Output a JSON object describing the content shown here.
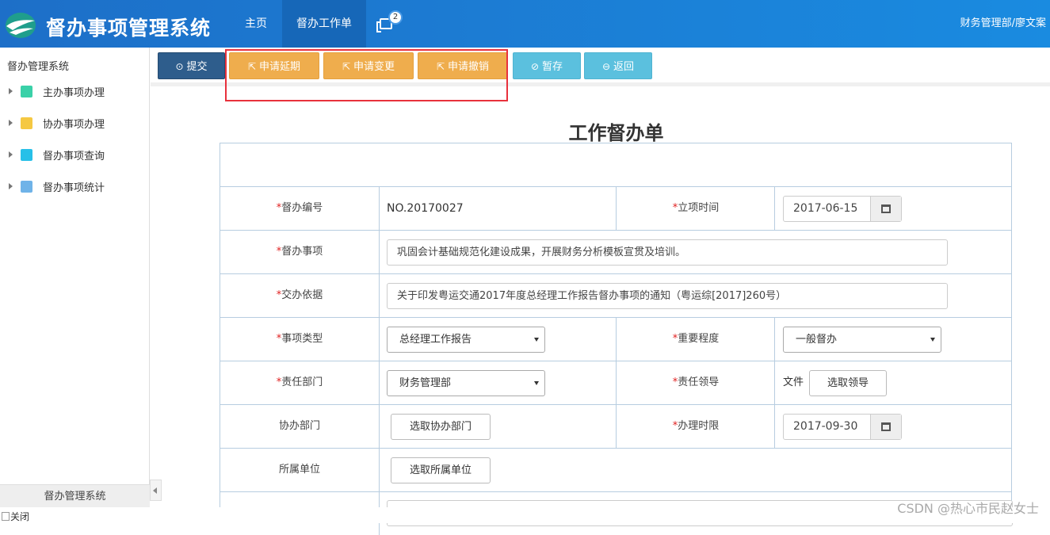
{
  "header": {
    "app_title": "督办事项管理系统",
    "nav": {
      "home": "主页",
      "work_order": "督办工作单",
      "badge_count": "2"
    },
    "user": "财务管理部/廖文案"
  },
  "sidebar": {
    "title": "督办管理系统",
    "items": [
      {
        "label": "主办事项办理",
        "icon": "user-icon",
        "color": "#3ad1a8"
      },
      {
        "label": "协办事项办理",
        "icon": "users-icon",
        "color": "#f5c842"
      },
      {
        "label": "督办事项查询",
        "icon": "search-icon",
        "color": "#27c0e8"
      },
      {
        "label": "督办事项统计",
        "icon": "chart-icon",
        "color": "#6fb3e8"
      }
    ],
    "footer": "督办管理系统"
  },
  "toolbar": {
    "submit": "提交",
    "delay": "申请延期",
    "change": "申请变更",
    "cancel": "申请撤销",
    "save": "暂存",
    "back": "返回"
  },
  "form": {
    "title": "工作督办单",
    "req_mark": "*",
    "code_label": "督办编号",
    "code_value": "NO.20170027",
    "start_label": "立项时间",
    "start_value": "2017-06-15",
    "matter_label": "督办事项",
    "matter_value": "巩固会计基础规范化建设成果，开展财务分析模板宣贯及培训。",
    "basis_label": "交办依据",
    "basis_value": "关于印发粤运交通2017年度总经理工作报告督办事项的通知（粤运综[2017]260号）",
    "type_label": "事项类型",
    "type_value": "总经理工作报告",
    "importance_label": "重要程度",
    "importance_value": "一般督办",
    "dept_label": "责任部门",
    "dept_value": "财务管理部",
    "leader_label": "责任领导",
    "leader_prefix": "文件",
    "leader_button": "选取领导",
    "assist_label": "协办部门",
    "assist_button": "选取协办部门",
    "deadline_label": "办理时限",
    "deadline_value": "2017-09-30",
    "unit_label": "所属单位",
    "unit_button": "选取所属单位"
  },
  "footer": {
    "close_alt": "关闭",
    "watermark": "CSDN @热心市民赵女士"
  }
}
